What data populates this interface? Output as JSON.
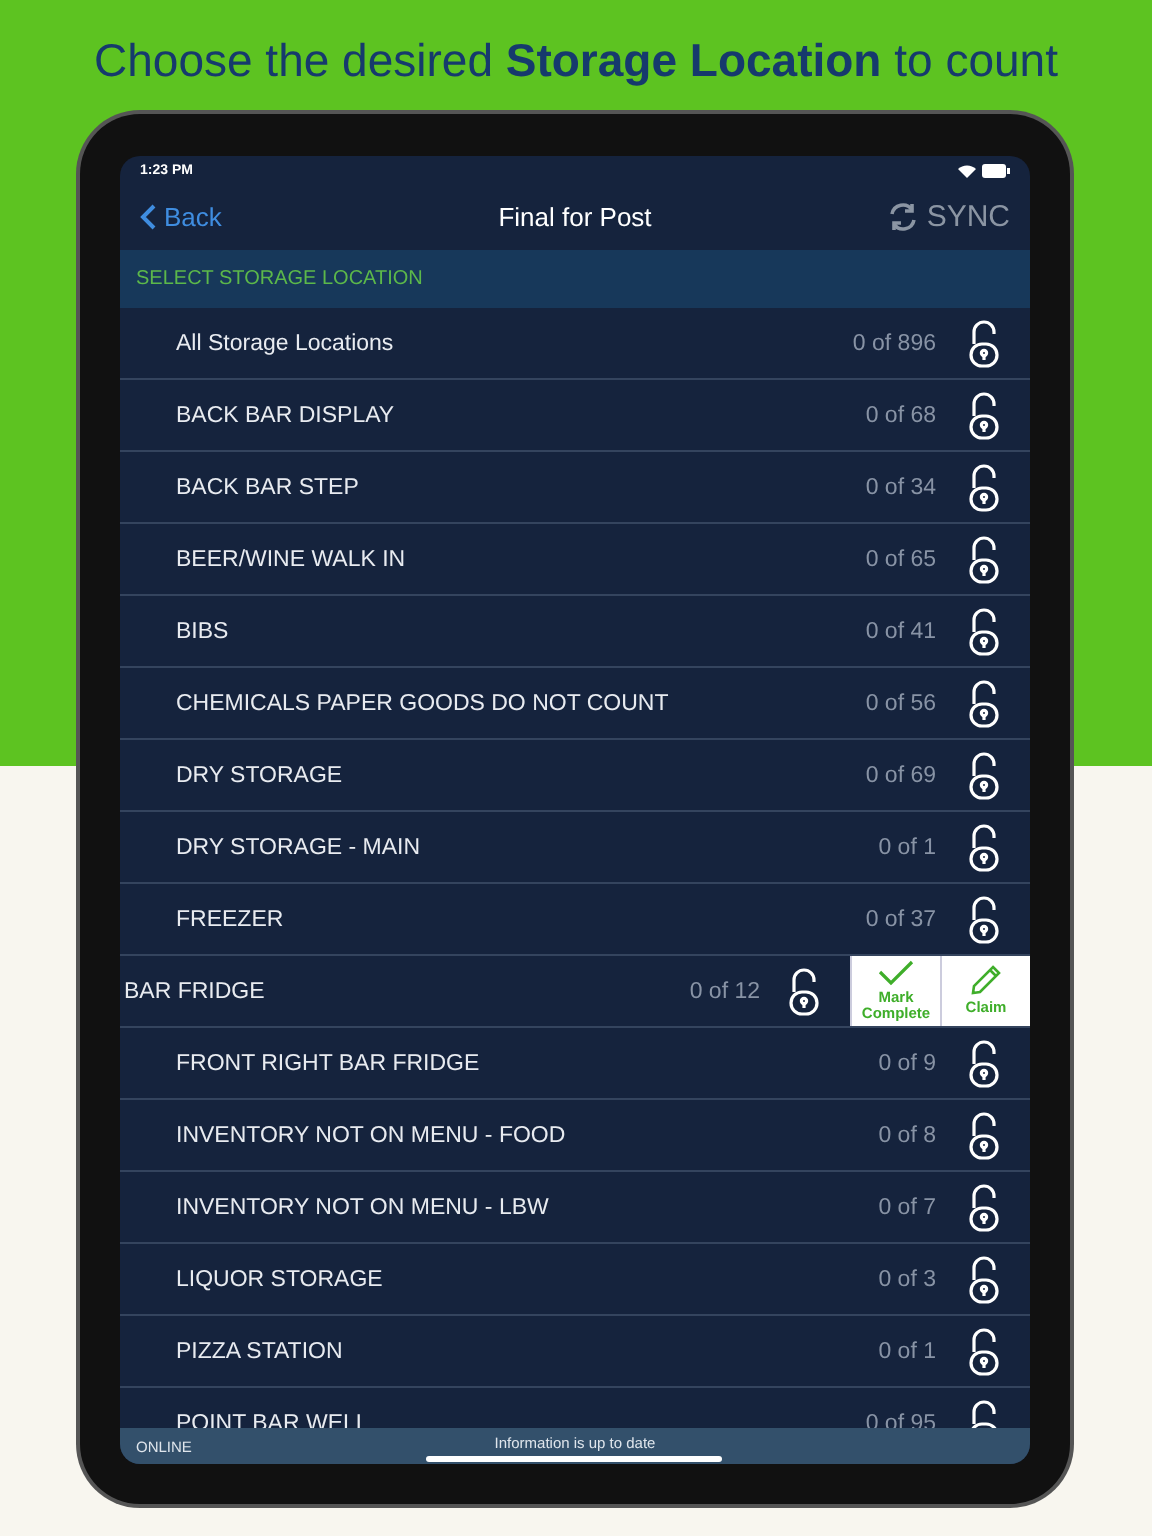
{
  "headline": "Choose the desired **Storage Location** to count",
  "status_bar": {
    "time": "1:23 PM"
  },
  "nav": {
    "back": "Back",
    "title": "Final for Post",
    "sync": "SYNC"
  },
  "section_header": "SELECT STORAGE LOCATION",
  "rows": [
    {
      "name": "All Storage Locations",
      "count": "0 of 896",
      "swiped": false
    },
    {
      "name": "BACK BAR DISPLAY",
      "count": "0 of 68",
      "swiped": false
    },
    {
      "name": "BACK BAR STEP",
      "count": "0 of 34",
      "swiped": false
    },
    {
      "name": "BEER/WINE WALK IN",
      "count": "0 of 65",
      "swiped": false
    },
    {
      "name": "BIBS",
      "count": "0 of 41",
      "swiped": false
    },
    {
      "name": "CHEMICALS PAPER GOODS DO NOT COUNT",
      "count": "0 of 56",
      "swiped": false
    },
    {
      "name": "DRY STORAGE",
      "count": "0 of 69",
      "swiped": false
    },
    {
      "name": "DRY STORAGE - MAIN",
      "count": "0 of 1",
      "swiped": false
    },
    {
      "name": "FREEZER",
      "count": "0 of 37",
      "swiped": false
    },
    {
      "name": "BAR FRIDGE",
      "count": "0 of 12",
      "swiped": true,
      "actions": [
        {
          "kind": "complete",
          "label": "Mark Complete"
        },
        {
          "kind": "claim",
          "label": "Claim"
        }
      ]
    },
    {
      "name": "FRONT RIGHT BAR FRIDGE",
      "count": "0 of 9",
      "swiped": false
    },
    {
      "name": "INVENTORY NOT ON MENU - FOOD",
      "count": "0 of 8",
      "swiped": false
    },
    {
      "name": "INVENTORY NOT ON MENU - LBW",
      "count": "0 of 7",
      "swiped": false
    },
    {
      "name": "LIQUOR STORAGE",
      "count": "0 of 3",
      "swiped": false
    },
    {
      "name": "PIZZA STATION",
      "count": "0 of 1",
      "swiped": false
    },
    {
      "name": "POINT BAR WELL",
      "count": "0 of 95",
      "swiped": false
    }
  ],
  "footer": {
    "connection": "ONLINE",
    "message": "Information is up to date"
  }
}
